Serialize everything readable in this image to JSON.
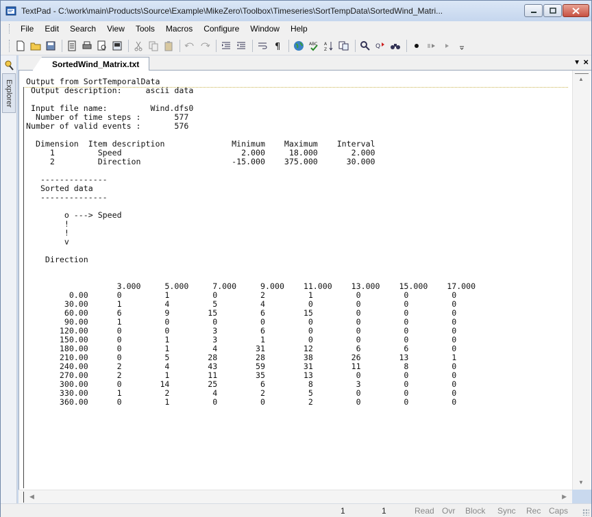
{
  "window": {
    "title": "TextPad - C:\\work\\main\\Products\\Source\\Example\\MikeZero\\Toolbox\\Timeseries\\SortTempData\\SortedWind_Matri..."
  },
  "menu": {
    "items": [
      "File",
      "Edit",
      "Search",
      "View",
      "Tools",
      "Macros",
      "Configure",
      "Window",
      "Help"
    ]
  },
  "explorer": {
    "label": "Explorer"
  },
  "document": {
    "tab_label": "SortedWind_Matrix.txt",
    "lines": [
      "Output from SortTemporalData",
      " Output description:     ascii data",
      "",
      " Input file name:         Wind.dfs0",
      "  Number of time steps :       577",
      "Number of valid events :       576",
      "",
      "  Dimension  Item description              Minimum    Maximum    Interval",
      "     1         Speed                         2.000     18.000       2.000",
      "     2         Direction                   -15.000    375.000      30.000",
      "",
      "   --------------",
      "   Sorted data",
      "   --------------",
      "",
      "        o ---> Speed",
      "        !",
      "        !",
      "        v",
      "",
      "    Direction",
      "",
      "",
      "                   3.000     5.000     7.000     9.000    11.000    13.000    15.000    17.000",
      "         0.00      0         1         0         2         1         0         0         0",
      "        30.00      1         4         5         4         0         0         0         0",
      "        60.00      6         9        15         6        15         0         0         0",
      "        90.00      1         0         0         0         0         0         0         0",
      "       120.00      0         0         3         6         0         0         0         0",
      "       150.00      0         1         3         1         0         0         0         0",
      "       180.00      0         1         4        31        12         6         6         0",
      "       210.00      0         5        28        28        38        26        13         1",
      "       240.00      2         4        43        59        31        11         8         0",
      "       270.00      2         1        11        35        13         0         0         0",
      "       300.00      0        14        25         6         8         3         0         0",
      "       330.00      1         2         4         2         5         0         0         0",
      "       360.00      0         1         0         0         2         0         0         0"
    ]
  },
  "status": {
    "line": "1",
    "column": "1",
    "read": "Read",
    "ovr": "Ovr",
    "block": "Block",
    "sync": "Sync",
    "rec": "Rec",
    "caps": "Caps"
  }
}
